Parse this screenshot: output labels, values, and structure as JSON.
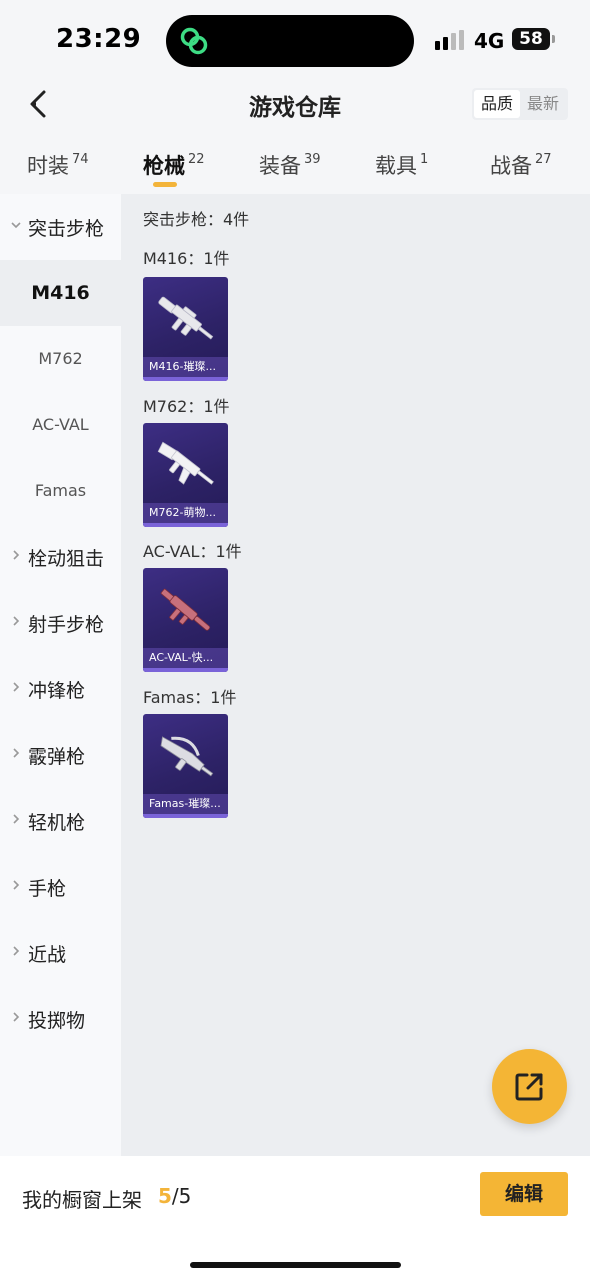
{
  "status_bar": {
    "time": "23:29",
    "network": "4G",
    "battery": "58",
    "island_icon": "link-rings-icon",
    "island_icon_color": "#3ddc84"
  },
  "header": {
    "title": "游戏仓库",
    "back_icon": "chevron-left-icon",
    "sort_options": [
      "品质",
      "最新"
    ],
    "active_sort": "品质"
  },
  "tabs": [
    {
      "label": "时装",
      "count": "74"
    },
    {
      "label": "枪械",
      "count": "22",
      "active": true
    },
    {
      "label": "装备",
      "count": "39"
    },
    {
      "label": "载具",
      "count": "1"
    },
    {
      "label": "战备",
      "count": "27"
    }
  ],
  "sidebar": {
    "expanded_category": "突击步枪",
    "sub_items": [
      "M416",
      "M762",
      "AC-VAL",
      "Famas"
    ],
    "active_sub": "M416",
    "categories": [
      "栓动狙击",
      "射手步枪",
      "冲锋枪",
      "霰弹枪",
      "轻机枪",
      "手枪",
      "近战",
      "投掷物"
    ]
  },
  "content": {
    "summary": "突击步枪：4件",
    "groups": [
      {
        "heading": "M416：1件",
        "item_caption": "M416-璀璨...",
        "gun_color": "#e8e8ec"
      },
      {
        "heading": "M762：1件",
        "item_caption": "M762-萌物...",
        "gun_color": "#f2f2f4"
      },
      {
        "heading": "AC-VAL：1件",
        "item_caption": "AC-VAL-快...",
        "gun_color": "#c7707c"
      },
      {
        "heading": "Famas：1件",
        "item_caption": "Famas-璀璨...",
        "gun_color": "#dcdce2"
      }
    ]
  },
  "share_button": {
    "icon": "share-external-icon"
  },
  "bottom_bar": {
    "label": "我的橱窗上架",
    "current": "5",
    "total": "/5",
    "edit_label": "编辑"
  },
  "colors": {
    "accent": "#f3b43a",
    "card_bg": "#2d2266",
    "content_bg": "#eceef1"
  }
}
